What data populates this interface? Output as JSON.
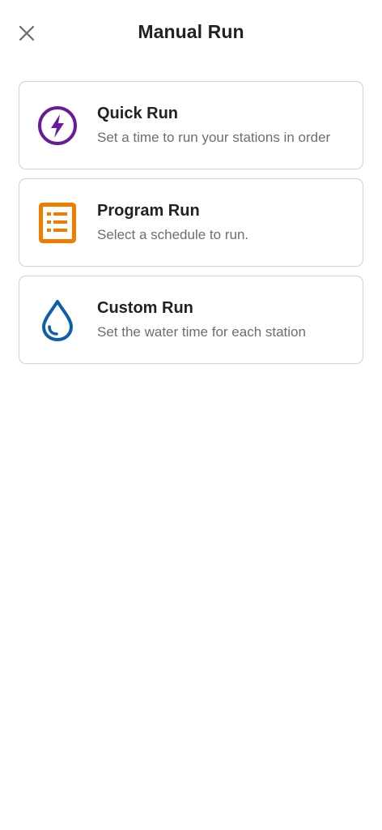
{
  "header": {
    "title": "Manual Run",
    "close_icon": "close-icon"
  },
  "colors": {
    "quick_run_icon": "#6a1b9a",
    "program_run_icon": "#f07c00",
    "custom_run_icon": "#0d5ea8",
    "card_border": "#d4d4d4",
    "subtitle_text": "#6e6e6e"
  },
  "options": [
    {
      "icon": "lightning-bolt-icon",
      "title": "Quick Run",
      "subtitle": "Set a time to run your stations in order"
    },
    {
      "icon": "list-icon",
      "title": "Program Run",
      "subtitle": "Select a schedule to run."
    },
    {
      "icon": "water-drop-icon",
      "title": "Custom Run",
      "subtitle": "Set the water time for each station"
    }
  ]
}
